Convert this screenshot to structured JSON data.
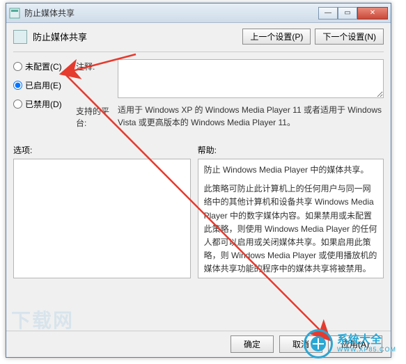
{
  "window": {
    "title": "防止媒体共享"
  },
  "header": {
    "title": "防止媒体共享",
    "prev_btn": "上一个设置(P)",
    "next_btn": "下一个设置(N)"
  },
  "radios": {
    "not_configured": "未配置(C)",
    "enabled": "已启用(E)",
    "disabled": "已禁用(D)",
    "selected": "enabled"
  },
  "fields": {
    "comment_label": "注释:",
    "comment_value": "",
    "platform_label": "支持的平台:",
    "platform_value": "适用于 Windows XP 的 Windows Media Player 11 或者适用于 Windows Vista 或更高版本的 Windows Media Player 11。"
  },
  "lower": {
    "options_label": "选项:",
    "help_label": "帮助:",
    "help_p1": "防止 Windows Media Player 中的媒体共享。",
    "help_p2": "此策略可防止此计算机上的任何用户与同一网络中的其他计算机和设备共享 Windows Media Player 中的数字媒体内容。如果禁用或未配置此策略，则使用 Windows Media Player 的任何人都可以启用或关闭媒体共享。如果启用此策略，则 Windows Media Player 或使用播放机的媒体共享功能的程序中的媒体共享将被禁用。"
  },
  "footer": {
    "ok": "确定",
    "cancel": "取消",
    "apply": "应用(A)"
  },
  "watermark": {
    "name": "系统大全",
    "url": "WWW.XP85.COM"
  }
}
